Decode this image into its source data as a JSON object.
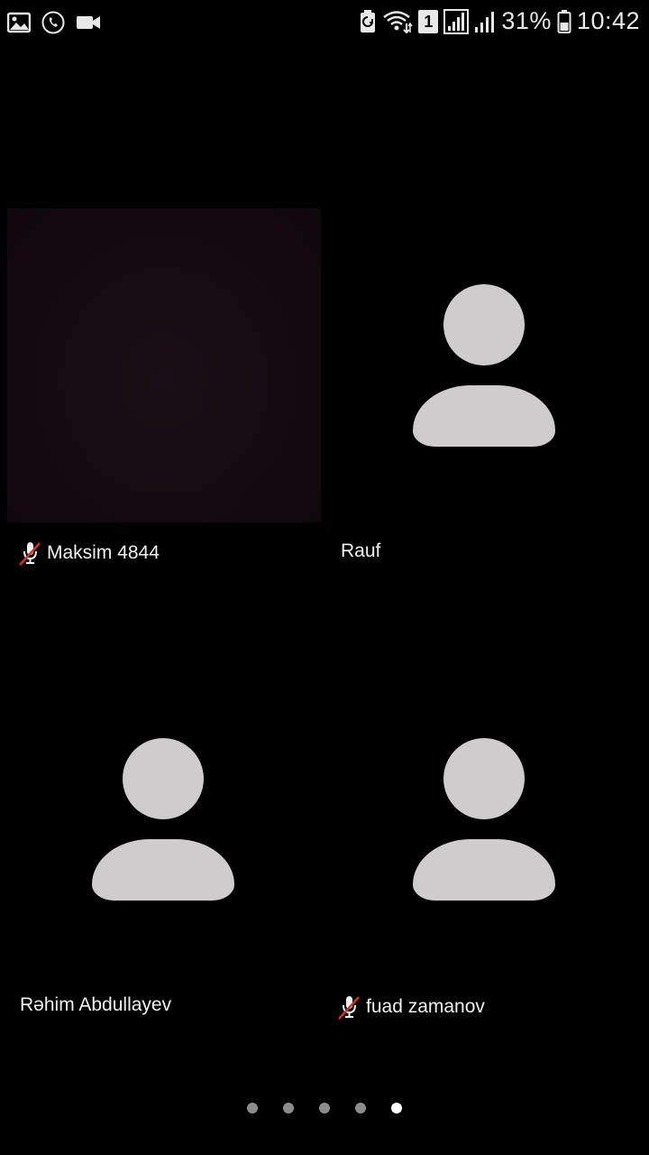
{
  "status_bar": {
    "left_icons": [
      "gallery-icon",
      "call-icon",
      "video-camera-icon"
    ],
    "sim_badge": "1",
    "battery_percent": "31%",
    "time": "10:42"
  },
  "participants": [
    {
      "name": "Maksim 4844",
      "muted": true,
      "video_on": true
    },
    {
      "name": "Rauf",
      "muted": false,
      "video_on": false
    },
    {
      "name": "Rəhim Abdullayev",
      "muted": false,
      "video_on": false
    },
    {
      "name": "fuad zamanov",
      "muted": true,
      "video_on": false
    }
  ],
  "pager": {
    "pages": 5,
    "active_page": 5
  },
  "colors": {
    "avatar": "#cfcccd",
    "muted_slash": "#d0332b",
    "background": "#000000"
  }
}
